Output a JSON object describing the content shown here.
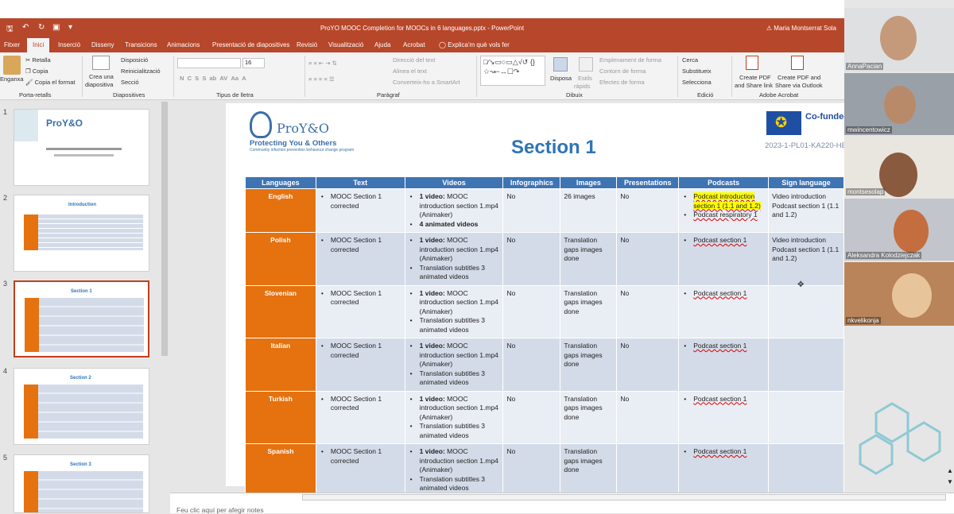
{
  "window": {
    "title": "ProYO MOOC Completion for MOOCs in 6 languages.pptx  -  PowerPoint",
    "user": "Maria Montserrat Sola"
  },
  "menu": [
    "Fitxer",
    "Inici",
    "Inserció",
    "Disseny",
    "Transicions",
    "Animacions",
    "Presentació de diapositives",
    "Revisió",
    "Visualització",
    "Ajuda",
    "Acrobat",
    "Explica'm què vols fer"
  ],
  "ribbon": {
    "paste": "Enganxa",
    "cut": "Retalla",
    "copy": "Copia",
    "format_painter": "Copia el format",
    "new_slide_1": "Crea una",
    "new_slide_2": "diapositiva",
    "layout": "Disposició",
    "reset": "Reinicialització",
    "section": "Secció",
    "font_size": "16",
    "text_dir": "Direcció del text",
    "align_text": "Alinea el text",
    "smartart": "Converteix-ho a SmartArt",
    "arrange": "Disposa",
    "quick_styles_1": "Estils",
    "quick_styles_2": "ràpids",
    "fill": "Emplenament de forma",
    "outline": "Contorn de forma",
    "effects": "Efectes de forma",
    "find": "Cerca",
    "replace": "Substitueix",
    "select": "Selecciona",
    "pdf_link_1": "Create PDF",
    "pdf_link_2": "and Share link",
    "pdf_outlook_1": "Create PDF and",
    "pdf_outlook_2": "Share via Outlook",
    "groups": [
      "Porta-retalls",
      "Diapositives",
      "Tipus de lletra",
      "Paràgraf",
      "Dibuix",
      "Edició",
      "Adobe Acrobat"
    ]
  },
  "thumbnails": [
    {
      "n": "1",
      "title": "ProY&O"
    },
    {
      "n": "2",
      "title": "Introduction"
    },
    {
      "n": "3",
      "title": "Section 1"
    },
    {
      "n": "4",
      "title": "Section 2"
    },
    {
      "n": "5",
      "title": "Section 3"
    }
  ],
  "slide": {
    "logo": "ProY&O",
    "logo_sub": "Protecting You & Others",
    "logo_tag": "Community infection prevention behaviour change program",
    "title": "Section 1",
    "cofunded": "Co-funded by the European Union",
    "project_code": "2023-1-PL01-KA220-HE",
    "headers": [
      "Languages",
      "Text",
      "Videos",
      "Infographics",
      "Images",
      "Presentations",
      "Podcasts",
      "Sign language"
    ],
    "rows": [
      {
        "lang": "English",
        "text": "MOOC Section 1 corrected",
        "videos": [
          {
            "b": "1 video:",
            "t": " MOOC introduction section 1.mp4 (Animaker)"
          },
          {
            "b": "4 animated videos",
            "t": ""
          }
        ],
        "info": "No",
        "images": "26 images",
        "pres": "No",
        "podcasts": [
          "Podcast introduction section 1 (1.1 and 1.2)",
          "Podcast respiratory 1"
        ],
        "sign": "Video introduction Podcast section 1 (1.1 and 1.2)"
      },
      {
        "lang": "Polish",
        "text": "MOOC Section 1 corrected",
        "videos": [
          {
            "b": "1 video:",
            "t": " MOOC introduction section 1.mp4 (Animaker)"
          },
          {
            "b": "",
            "t": "Translation subtitles 3 animated videos"
          }
        ],
        "info": "No",
        "images": "Translation gaps images done",
        "pres": "No",
        "podcasts": [
          "Podcast section 1"
        ],
        "sign": "Video introduction Podcast section 1 (1.1 and 1.2)"
      },
      {
        "lang": "Slovenian",
        "text": "MOOC Section 1 corrected",
        "videos": [
          {
            "b": "1 video:",
            "t": " MOOC introduction section 1.mp4 (Animaker)"
          },
          {
            "b": "",
            "t": "Translation subtitles 3 animated videos"
          }
        ],
        "info": "No",
        "images": "Translation gaps images done",
        "pres": "No",
        "podcasts": [
          "Podcast section 1"
        ],
        "sign": ""
      },
      {
        "lang": "Italian",
        "text": "MOOC Section 1 corrected",
        "videos": [
          {
            "b": "1 video:",
            "t": " MOOC introduction section 1.mp4 (Animaker)"
          },
          {
            "b": "",
            "t": "Translation subtitles 3 animated videos"
          }
        ],
        "info": "No",
        "images": "Translation gaps images done",
        "pres": "No",
        "podcasts": [
          "Podcast section 1"
        ],
        "sign": ""
      },
      {
        "lang": "Turkish",
        "text": "MOOC Section 1 corrected",
        "videos": [
          {
            "b": "1 video:",
            "t": " MOOC introduction section 1.mp4 (Animaker)"
          },
          {
            "b": "",
            "t": "Translation subtitles 3 animated videos"
          }
        ],
        "info": "No",
        "images": "Translation gaps images done",
        "pres": "No",
        "podcasts": [
          "Podcast section 1"
        ],
        "sign": ""
      },
      {
        "lang": "Spanish",
        "text": "MOOC Section 1 corrected",
        "videos": [
          {
            "b": "1 video:",
            "t": " MOOC introduction section 1.mp4 (Animaker)"
          },
          {
            "b": "",
            "t": "Translation subtitles 3 animated videos"
          }
        ],
        "info": "No",
        "images": "Translation gaps images done",
        "pres": "",
        "podcasts": [
          "Podcast  section 1"
        ],
        "sign": ""
      }
    ]
  },
  "notes": "Feu clic aquí per afegir notes",
  "participants": [
    "AnnaPacian",
    "mwincentowicz",
    "montsesolap",
    "Aleksandra Kolodziejczak",
    "nkvelikonja"
  ],
  "colors": {
    "accent": "#b7472a",
    "lang_col": "#e5720f",
    "header": "#3f74b3",
    "section_title": "#2e75b6"
  }
}
